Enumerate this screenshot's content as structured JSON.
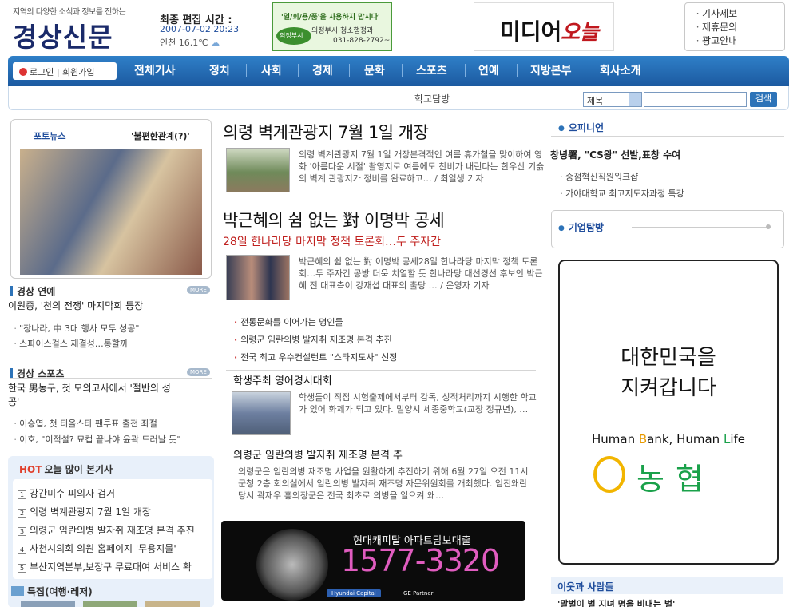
{
  "header": {
    "tagline": "지역의 다양한 소식과 정보를 전하는",
    "logo": "경상신문",
    "edit_label": "최종 편집 시간 :",
    "edit_time": "2007-07-02 20:23",
    "weather": "인천 16.1℃",
    "ad_campaign": {
      "line1": "'일/회/용/품'을 사용하지 맙시다'",
      "line2": "의정부시 청소행정과",
      "line3": "031-828-2792~3",
      "badge": "의정부시"
    },
    "ad_media": {
      "part1": "미디어",
      "part2": "오늘"
    },
    "top_links": [
      "기사제보",
      "제휴문의",
      "광고안내"
    ]
  },
  "nav": {
    "login": "로그인 | 회원가입",
    "items": [
      "전체기사",
      "정치",
      "사회",
      "경제",
      "문화",
      "스포츠",
      "연예",
      "지방본부",
      "회사소개"
    ],
    "sub": "학교탐방",
    "search_select": "제목",
    "search_button": "검색"
  },
  "left": {
    "photo_news": {
      "label": "포토뉴스",
      "caption": "'불편한관계(?)'"
    },
    "ent": {
      "title": "경상 연예",
      "more": "MORE",
      "headline": "이원종, '천의 전쟁' 마지막회 등장",
      "items": [
        "\"장나라, 中 3대 행사 모두 성공\"",
        "스파이스걸스 재결성…통할까"
      ]
    },
    "sports": {
      "title": "경상 스포츠",
      "more": "MORE",
      "headline1": "한국 男농구, 첫 모의고사에서 '절반의 성",
      "headline2": "공'",
      "items": [
        "이승엽, 첫 티올스타 팬투표 출전 좌절",
        "이호, \"이적설? 묘컵 끝나야 윤곽 드러날 듯\""
      ]
    },
    "hot": {
      "hot": "HOT",
      "title": "오늘 많이 본기사",
      "items": [
        "강간미수 피의자 검거",
        "의령 벽계관광지 7월 1일 개장",
        "의령군 임란의병 발자취 재조명 본격 추진",
        "사천시의회 의원 홈페이지 '무용지물'",
        "부산지역본부,보장구 무료대여 서비스 확"
      ]
    },
    "special": "특집(여행·레저)"
  },
  "center": {
    "a1": {
      "title": "의령 벽계관광지 7월 1일 개장",
      "body": "의령 벽계관광지 7월 1일 개장본격적인 여름 휴가철을 맞이하여 영화 '아름다운 시절' 촬영지로 여름에도 찬비가 내린다는 한우산 기슭의 벽계 관광지가 정비를 완료하고… / 최일생 기자"
    },
    "a2": {
      "title": "박근혜의 쉼 없는 對 이명박 공세",
      "subtitle": "28일 한나라당 마지막 정책 토론회…두 주자간",
      "body": "박근혜의 쉼 없는 對 이명박 공세28일 한나라당 마지막 정책 토론회…두 주자간 공방 더욱 치열할 듯 한나라당 대선경선 후보인 박근혜 전 대표측이 강재섭 대표의 출당 … / 운영자 기자"
    },
    "bullets": [
      "전통문화를 이어가는 명인들",
      "의령군 임란의병 발자취 재조명 본격 추진",
      "전국 최고 우수컨설턴트 \"스타지도사\" 선정"
    ],
    "a3": {
      "title": "학생주최 영어경시대회",
      "body": "학생들이 직접 시험출제에서부터 감독, 성적처리까지 시행한 학교가 있어 화제가 되고 있다. 밀양시 세종중학교(교장 정규년), …"
    },
    "a4": {
      "title": "의령군 임란의병 발자취 재조명 본격 추",
      "body": "의령군은 임란의병 재조명 사업을 원활하게 추진하기 위해 6월 27일 오전 11시 군청 2층 회의실에서 임란의병 발자취 재조명 자문위원회를 개최했다. 임진왜란 당시 곽재우 홍의장군은 전국 최초로 의병을 일으켜 왜…"
    },
    "banner": {
      "line1": "현대캐피탈 아파트담보대출",
      "phone": "1577-3320",
      "brand": "Hyundai Capital",
      "partner": "GE Partner"
    }
  },
  "right": {
    "opinion": {
      "title": "오피니언",
      "headline": "창녕署, \"CS왕\" 선발,표창 수여",
      "items": [
        "중점혁신직원워크샵",
        "가야대학교 최고지도자과정 특강"
      ]
    },
    "biz": {
      "title": "기업탐방"
    },
    "ad": {
      "line1": "대한민국을",
      "line2": "지켜갑니다",
      "slogan_a": "Human ",
      "slogan_b": "B",
      "slogan_c": "ank, Human ",
      "slogan_d": "L",
      "slogan_e": "ife",
      "brand": "농협"
    },
    "neighbors": {
      "title": "이웃과 사람들",
      "item": "'말벌이 벌 지녀 명을 비내는 벌'"
    }
  }
}
